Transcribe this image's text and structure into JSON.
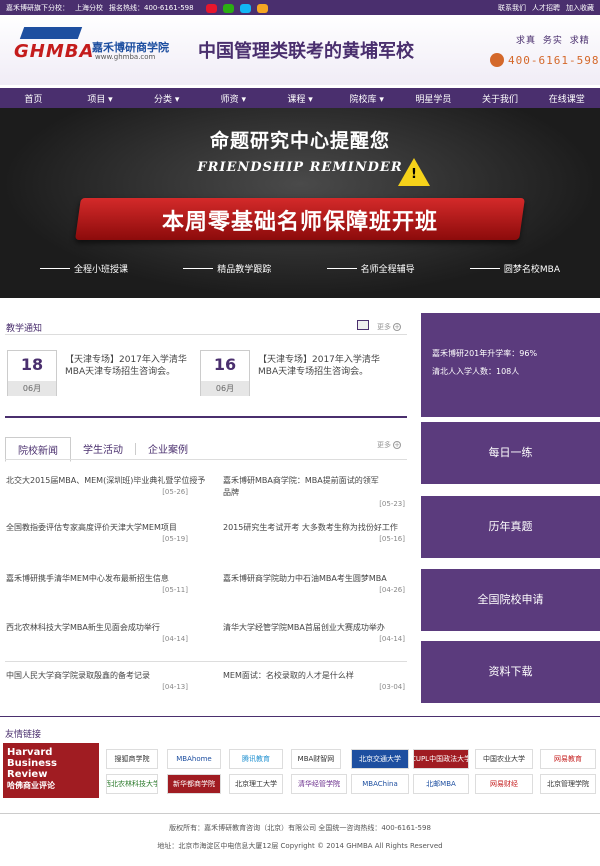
{
  "topbar": {
    "org_label": "嘉禾博研旗下分校：",
    "branch": "上海分校",
    "hotline_label": "报名热线：400-6161-598",
    "links": [
      "联系我们",
      "人才招聘",
      "加入收藏"
    ]
  },
  "header": {
    "logo_letters": "GHMBA",
    "brand_name": "嘉禾博研商学院",
    "brand_url": "www.ghmba.com",
    "slogan": "中国管理类联考的黄埔军校",
    "motto": "求真 务实 求精",
    "phone": "400-6161-598"
  },
  "nav": {
    "items": [
      "首页",
      "项目 ▾",
      "分类 ▾",
      "师资 ▾",
      "课程 ▾",
      "院校库 ▾",
      "明星学员",
      "关于我们",
      "在线课堂"
    ]
  },
  "banner": {
    "title": "命题研究中心提醒您",
    "subtitle": "FRIENDSHIP REMINDER",
    "warning_mark": "!",
    "headline": "本周零基础名师保障班开班",
    "features": [
      "全程小班授课",
      "精品教学跟踪",
      "名师全程辅导",
      "圆梦名校MBA"
    ]
  },
  "notices": {
    "title": "教学通知",
    "more": "更多",
    "items": [
      {
        "day": "18",
        "month": "06月",
        "text": "【天津专场】2017年入学清华MBA天津专场招生咨询会。"
      },
      {
        "day": "16",
        "month": "06月",
        "text": "【天津专场】2017年入学清华MBA天津专场招生咨询会。"
      }
    ]
  },
  "news": {
    "tabs": [
      "院校新闻",
      "学生活动",
      "企业案例"
    ],
    "more": "更多",
    "items": [
      {
        "title": "北交大2015届MBA、MEM(深圳班)毕业典礼暨学位授予",
        "date": "[05-26]"
      },
      {
        "title": "嘉禾博研MBA商学院：MBA提前面试的领军品牌",
        "date": "[05-23]"
      },
      {
        "title": "全国教指委评估专家高度评价天津大学MEM项目",
        "date": "[05-19]"
      },
      {
        "title": "2015研究生考试开考 大多数考生称为找份好工作",
        "date": "[05-16]"
      },
      {
        "title": "嘉禾博研携手清华MEM中心发布最新招生信息",
        "date": "[05-11]"
      },
      {
        "title": "嘉禾博研商学院助力中石油MBA考生圆梦MBA",
        "date": "[04-26]"
      },
      {
        "title": "西北农林科技大学MBA新生见面会成功举行",
        "date": "[04-14]"
      },
      {
        "title": "清华大学经管学院MBA首届创业大赛成功举办",
        "date": "[04-14]"
      },
      {
        "title": "中国人民大学商学院录取殷鑫的备考记录",
        "date": "[04-13]"
      },
      {
        "title": "MEM面试：名校录取的人才是什么样",
        "date": "[03-04]"
      }
    ]
  },
  "sidebar": {
    "stats": [
      "嘉禾博研201年升学率：96%",
      "清北人入学人数：108人"
    ],
    "buttons": [
      "每日一练",
      "历年真题",
      "全国院校申请",
      "资料下载"
    ]
  },
  "links": {
    "title": "友情链接",
    "hbr_lines": [
      "Harvard",
      "Business",
      "Review",
      "哈佛商业评论"
    ],
    "logos": [
      "搜狐商学院",
      "MBAhome",
      "腾讯教育",
      "MBA财智网",
      "北京交通大学",
      "CUPL中国政法大学",
      "中国农业大学",
      "网易教育",
      "西北农林科技大学",
      "新华都商学院",
      "北京理工大学",
      "清华经管学院",
      "MBAChina",
      "北邮MBA",
      "网易财经",
      "北京管理学院"
    ]
  },
  "footer": {
    "line1": "版权所有：嘉禾博研教育咨询（北京）有限公司 全国统一咨询热线：400-6161-598",
    "line2": "地址：北京市海淀区中电信息大厦12层  Copyright © 2014 GHMBA  All Rights Reserved"
  },
  "colors": {
    "brand_purple": "#4a2f6e",
    "side_purple": "#5b3b7d",
    "accent_red": "#c41c1c",
    "phone_orange": "#d4682a"
  }
}
